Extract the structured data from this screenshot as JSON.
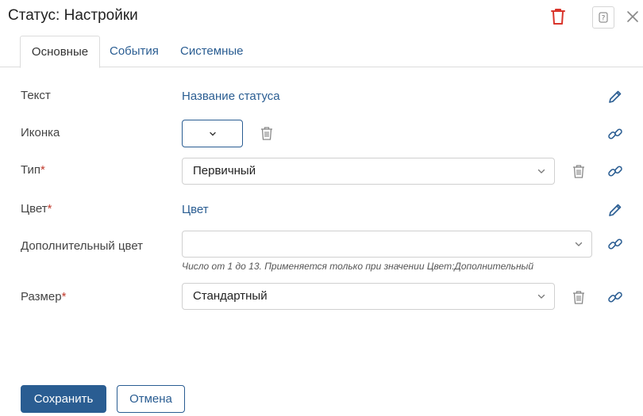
{
  "dialog": {
    "title": "Статус: Настройки",
    "help_label": "?"
  },
  "tabs": [
    {
      "label": "Основные",
      "active": true
    },
    {
      "label": "События",
      "active": false
    },
    {
      "label": "Системные",
      "active": false
    }
  ],
  "fields": {
    "text": {
      "label": "Текст",
      "value": "Название статуса"
    },
    "icon": {
      "label": "Иконка",
      "value": ""
    },
    "type": {
      "label": "Тип",
      "required_mark": "*",
      "value": "Первичный"
    },
    "color": {
      "label": "Цвет",
      "required_mark": "*",
      "value": "Цвет"
    },
    "extra_color": {
      "label": "Дополнительный цвет",
      "value": "",
      "hint": "Число от 1 до 13. Применяется только при значении Цвет:Дополнительный"
    },
    "size": {
      "label": "Размер",
      "required_mark": "*",
      "value": "Стандартный"
    }
  },
  "footer": {
    "save_label": "Сохранить",
    "cancel_label": "Отмена"
  },
  "colors": {
    "accent": "#2a5d92",
    "danger": "#d9342b",
    "required": "#c0392b"
  },
  "icons": [
    "trash-icon",
    "help-icon",
    "close-icon",
    "chevron-down-icon",
    "pencil-icon",
    "link-icon"
  ]
}
